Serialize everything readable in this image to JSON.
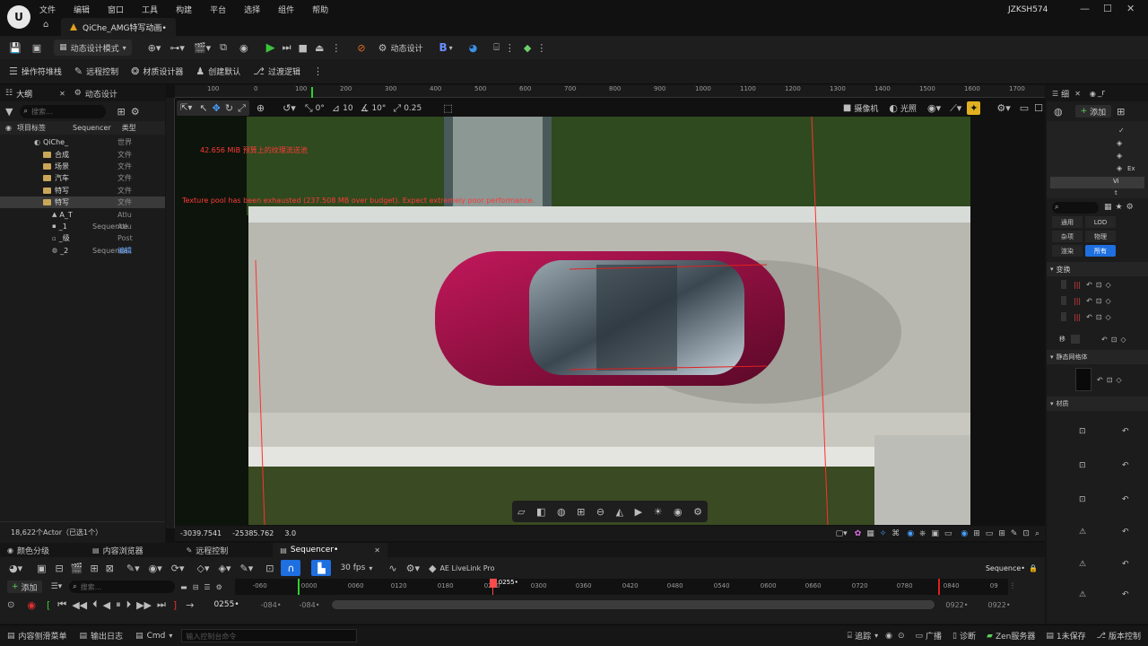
{
  "menu": [
    "文件",
    "编辑",
    "窗口",
    "工具",
    "构建",
    "平台",
    "选择",
    "组件",
    "帮助"
  ],
  "user": "JZKSH574",
  "document_tab": "QiChe_AMG特写动画•",
  "toolbar1": {
    "mode_label": "动态设计模式",
    "sequence_label": "动态设计",
    "b_label": "B"
  },
  "toolbar2": [
    "操作符堆栈",
    "远程控制",
    "材质设计器",
    "创建默认",
    "过渡逻辑"
  ],
  "outliner": {
    "tabs": [
      "大纲",
      "动态设计"
    ],
    "search_placeholder": "搜索...",
    "col_label": "项目标签",
    "col_sequencer": "Sequencer",
    "col_type": "类型",
    "rows": [
      {
        "indent": 1,
        "name": "QiChe_",
        "type": "世界",
        "kind": "world"
      },
      {
        "indent": 2,
        "name": "合成",
        "type": "文件",
        "kind": "folder"
      },
      {
        "indent": 2,
        "name": "场景",
        "type": "文件",
        "kind": "folder"
      },
      {
        "indent": 2,
        "name": "汽车",
        "type": "文件",
        "kind": "folder"
      },
      {
        "indent": 2,
        "name": "特写",
        "type": "文件",
        "kind": "folder"
      },
      {
        "indent": 2,
        "name": "特写",
        "type": "文件",
        "kind": "folder",
        "selected": true
      },
      {
        "indent": 2,
        "name": "A_T",
        "type": "Atlu",
        "kind": "actor"
      },
      {
        "indent": 2,
        "name": "_1",
        "seq": "Sequence",
        "type": "Atlu",
        "kind": "actor"
      },
      {
        "indent": 2,
        "name": "_级",
        "type": "Post",
        "kind": "actor"
      },
      {
        "indent": 2,
        "name": "_2",
        "seq": "Sequence",
        "type": "编辑",
        "kind": "actor",
        "blue": true
      }
    ],
    "footer": "18,622个Actor（已选1个）"
  },
  "viewport": {
    "ruler": [
      "100",
      "0",
      "100",
      "200",
      "300",
      "400",
      "500",
      "600",
      "700",
      "800",
      "900",
      "1000",
      "1100",
      "1200",
      "1300",
      "1400",
      "1500",
      "1600",
      "1700"
    ],
    "tools": {
      "snap_angle": "10°",
      "grid": "10",
      "rot": "0°",
      "scale": "0.25"
    },
    "camera_label": "摄像机",
    "lit_label": "光照",
    "warn1": "42.656 MiB 预算上的纹理流送池",
    "warn2": "Texture pool has been exhausted (237.508 MB over budget). Expect extremely poor performance.",
    "coords": [
      "-3039.7541",
      "-25385.762",
      "3.0"
    ]
  },
  "details": {
    "tabs": [
      "细",
      "_r"
    ],
    "add_label": "添加",
    "items": [
      "Ex",
      "Vi",
      "t"
    ],
    "filters": [
      "通用",
      "LOD",
      "杂项",
      "物理",
      "渲染",
      "所有"
    ],
    "sections": [
      "变换",
      "静态网格体",
      "材质"
    ],
    "move_label": "移"
  },
  "bottom_tabs": [
    "颜色分级",
    "内容浏览器",
    "远程控制",
    "Sequencer•"
  ],
  "sequencer": {
    "add_label": "添加",
    "search_placeholder": "搜索...",
    "fps": "30 fps",
    "livelink": "AE LiveLink Pro",
    "name": "Sequence•",
    "timeline": [
      "-060",
      "0000",
      "0060",
      "0120",
      "0180",
      "0240",
      "0300",
      "0360",
      "0420",
      "0480",
      "0540",
      "0600",
      "0660",
      "0720",
      "0780",
      "0840",
      "09"
    ],
    "playhead": "0255•",
    "current_frame": "0255•",
    "range_start": "-084•",
    "range_start2": "-084•",
    "range_end": "0922•",
    "range_end2": "0922•"
  },
  "statusbar": {
    "left": [
      "内容侧滑菜单",
      "输出日志"
    ],
    "cmd": "Cmd",
    "cmd_placeholder": "输入控制台命令",
    "right": [
      "追踪",
      "广播",
      "诊断",
      "Zen服务器",
      "1未保存",
      "版本控制"
    ]
  }
}
